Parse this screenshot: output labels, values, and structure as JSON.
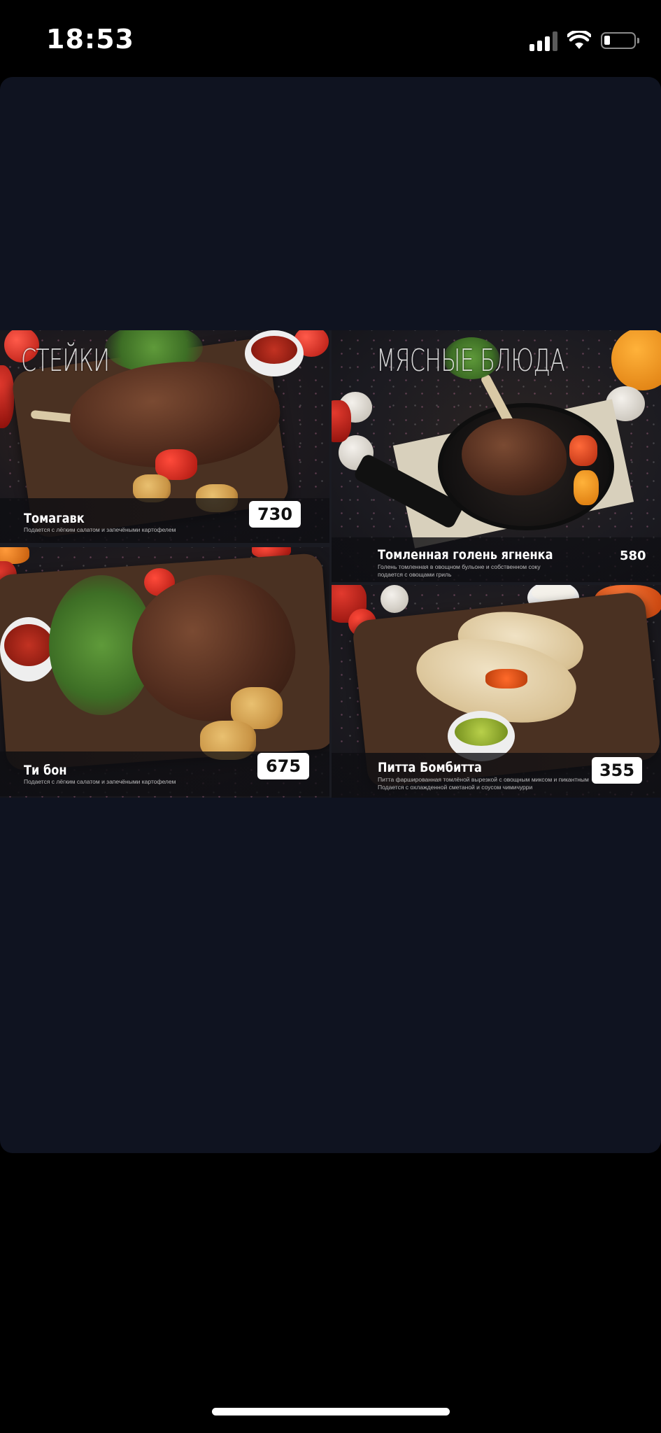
{
  "status_bar": {
    "time": "18:53",
    "battery_level": 0.2
  },
  "menu": {
    "sections": {
      "steaks": "СТЕЙКИ",
      "meat_dishes": "МЯСНЫЕ БЛЮДА"
    },
    "items": [
      {
        "name": "Томагавк",
        "description": "Подается с лёгким салатом и запечёными картофелем",
        "price": "730"
      },
      {
        "name": "Томленная голень ягненка",
        "description_line1": "Голень томленная в овощном бульоне и собственном соку",
        "description_line2": "подается с овощами гриль",
        "price": "580"
      },
      {
        "name": "Ти бон",
        "description": "Подается с лёгким салатом и запечёными картофелем",
        "price": "675"
      },
      {
        "name": "Питта Бомбитта",
        "description_line1": "Питта фаршированная томлёной вырезкой с овощным миксом и пикантным",
        "description_line2": "Подается с охлажденной сметаной и соусом чимичурри",
        "price": "355"
      }
    ]
  }
}
